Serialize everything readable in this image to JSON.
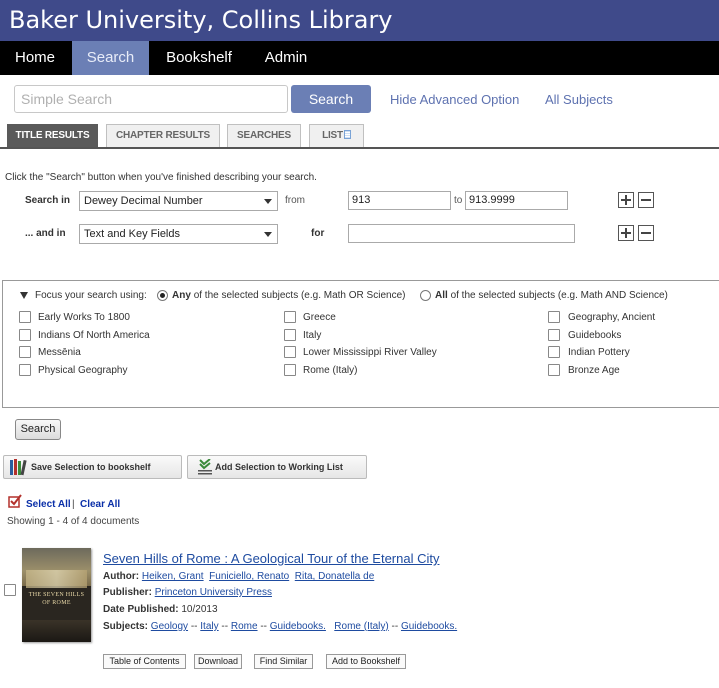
{
  "header": {
    "title": "Baker University, Collins Library"
  },
  "nav": {
    "items": [
      "Home",
      "Search",
      "Bookshelf",
      "Admin"
    ],
    "active": "Search"
  },
  "simple_search": {
    "placeholder": "Simple Search",
    "button": "Search",
    "advanced_link": "Hide Advanced Option",
    "subjects_link": "All Subjects"
  },
  "tabs": {
    "title_results": "TITLE RESULTS",
    "chapter_results": "CHAPTER RESULTS",
    "searches": "SEARCHES",
    "list": "LIST"
  },
  "advanced": {
    "hint": "Click the \"Search\" button when you've finished describing your search.",
    "row1": {
      "label": "Search in",
      "field": "Dewey Decimal Number",
      "from_label": "from",
      "from_value": "913",
      "to_label": "to",
      "to_value": "913.9999"
    },
    "row2": {
      "label": "... and in",
      "field": "Text and Key Fields",
      "for_label": "for",
      "for_value": ""
    }
  },
  "focus": {
    "label": "Focus your search using:",
    "any_bold": "Any",
    "any_text": "of the selected subjects (e.g. Math OR Science)",
    "all_bold": "All",
    "all_text": "of the selected subjects (e.g. Math AND Science)",
    "subjects": [
      [
        "Early Works To 1800",
        "Indians Of North America",
        "Messēnia",
        "Physical Geography"
      ],
      [
        "Greece",
        "Italy",
        "Lower Mississippi River Valley",
        "Rome (Italy)"
      ],
      [
        "Geography, Ancient",
        "Guidebooks",
        "Indian Pottery",
        "Bronze Age"
      ]
    ]
  },
  "search_button": "Search",
  "toolbar": {
    "save_bookshelf": "Save Selection to bookshelf",
    "add_working_list": "Add Selection to Working List"
  },
  "selection": {
    "select_all": "Select All",
    "sep": "|",
    "clear_all": "Clear All",
    "showing": "Showing 1 - 4 of 4 documents"
  },
  "result": {
    "title": "Seven Hills of Rome : A Geological Tour of the Eternal City",
    "author_label": "Author:",
    "authors": [
      "Heiken, Grant",
      "Funiciello, Renato",
      "Rita, Donatella de"
    ],
    "publisher_label": "Publisher:",
    "publisher": "Princeton University Press",
    "date_label": "Date Published:",
    "date": "10/2013",
    "subjects_label": "Subjects:",
    "subjects_a": [
      "Geology",
      "Italy",
      "Rome",
      "Guidebooks."
    ],
    "subjects_b": [
      "Rome (Italy)",
      "Guidebooks."
    ],
    "sep": "--",
    "cover_text": "THE SEVEN HILLS OF ROME",
    "actions": [
      "Table of Contents",
      "Download",
      "Find Similar",
      "Add to Bookshelf"
    ]
  },
  "colors": {
    "header_bg": "#3f4a8a",
    "nav_bg": "#000000",
    "accent": "#6b7fb5",
    "link": "#1e4ba0"
  }
}
